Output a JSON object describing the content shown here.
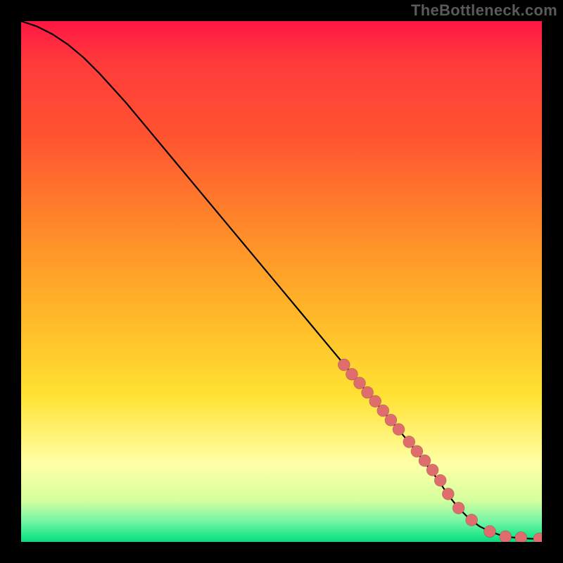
{
  "watermark": "TheBottleneck.com",
  "colors": {
    "frame": "#000000",
    "curve": "#000000",
    "marker": "#e06d6d",
    "gradient_top": "#ff1744",
    "gradient_bottom": "#0fd67c"
  },
  "chart_data": {
    "type": "line",
    "title": "",
    "xlabel": "",
    "ylabel": "",
    "xlim": [
      0,
      100
    ],
    "ylim": [
      0,
      100
    ],
    "grid": false,
    "legend": false,
    "curve": {
      "name": "bottleneck-curve",
      "x": [
        0,
        3,
        6,
        9,
        12,
        15,
        20,
        25,
        30,
        35,
        40,
        45,
        50,
        55,
        60,
        65,
        70,
        75,
        80,
        82,
        84,
        86,
        88,
        90,
        92,
        94,
        96,
        98,
        100
      ],
      "y": [
        100,
        99,
        97.5,
        95.5,
        93,
        90,
        84.5,
        78.5,
        72.5,
        66.5,
        60.5,
        54.5,
        48.5,
        42.5,
        36.5,
        30.5,
        24.5,
        18.5,
        12,
        9,
        6.5,
        4.5,
        3,
        2,
        1.3,
        0.9,
        0.7,
        0.6,
        0.6
      ]
    },
    "series": [
      {
        "name": "markers",
        "type": "scatter",
        "x": [
          62,
          63.5,
          65,
          66.5,
          68,
          69.5,
          71,
          72.5,
          74.5,
          76,
          77.5,
          79,
          80.5,
          82,
          84,
          86.5,
          90,
          93,
          96,
          99.5
        ],
        "y": [
          34,
          32.2,
          30.5,
          28.7,
          27,
          25.2,
          23.4,
          21.6,
          19.2,
          17.4,
          15.6,
          13.8,
          11.8,
          9.2,
          6.5,
          4.2,
          2,
          1,
          0.8,
          0.6
        ]
      }
    ]
  }
}
